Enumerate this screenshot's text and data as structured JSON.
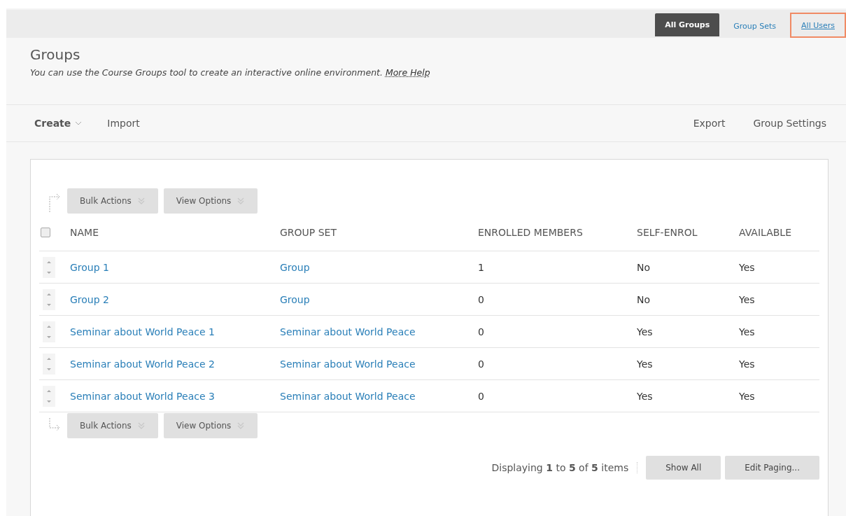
{
  "nav_tabs": [
    {
      "label": "All Groups",
      "selected": true,
      "highlighted": false
    },
    {
      "label": "Group Sets",
      "selected": false,
      "highlighted": false
    },
    {
      "label": "All Users",
      "selected": false,
      "highlighted": true
    }
  ],
  "page": {
    "title": "Groups",
    "description": "You can use the Course Groups tool to create an interactive online environment.",
    "help_link": "More Help"
  },
  "toolbar": {
    "left": [
      {
        "label": "Create",
        "kind": "menu"
      },
      {
        "label": "Import",
        "kind": "plain"
      }
    ],
    "right": [
      "Export",
      "Group Settings"
    ]
  },
  "action_bar": [
    "Bulk Actions",
    "View Options"
  ],
  "table": {
    "select_all_checked": false,
    "columns": [
      "NAME",
      "GROUP SET",
      "ENROLLED MEMBERS",
      "SELF-ENROL",
      "AVAILABLE"
    ],
    "rows": [
      [
        "Group 1",
        "Group",
        "1",
        "No",
        "Yes"
      ],
      [
        "Group 2",
        "Group",
        "0",
        "No",
        "Yes"
      ],
      [
        "Seminar about World Peace 1",
        "Seminar about World Peace",
        "0",
        "Yes",
        "Yes"
      ],
      [
        "Seminar about World Peace 2",
        "Seminar about World Peace",
        "0",
        "Yes",
        "Yes"
      ],
      [
        "Seminar about World Peace 3",
        "Seminar about World Peace",
        "0",
        "Yes",
        "Yes"
      ]
    ]
  },
  "bottom_action_bar": [
    "Bulk Actions",
    "View Options"
  ],
  "paging": {
    "summary": "Displaying **1** to **5** of **5** items",
    "buttons": [
      "Show All",
      "Edit Paging..."
    ]
  }
}
